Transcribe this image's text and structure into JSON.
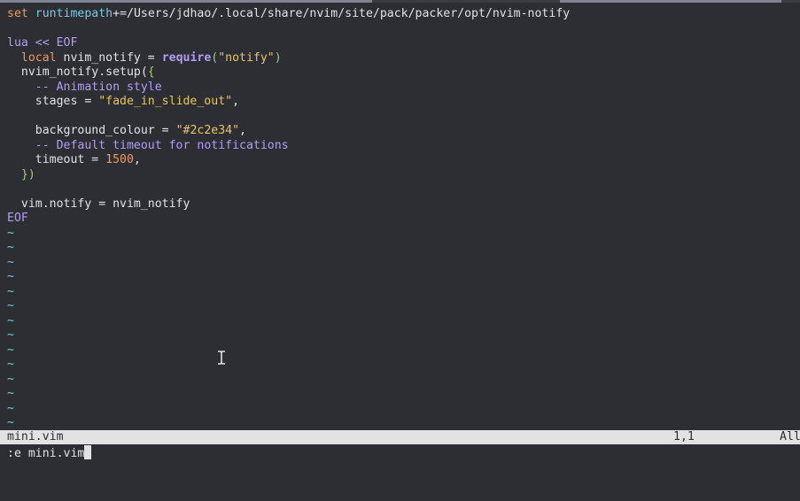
{
  "editor": {
    "lines": [
      [
        {
          "t": "set",
          "c": "kw"
        },
        {
          "t": " "
        },
        {
          "t": "runtimepath",
          "c": "hl"
        },
        {
          "t": "+=/Users/jdhao/.local/share/nvim/site/pack/packer/opt/nvim-notify"
        }
      ],
      [],
      [
        {
          "t": "lua << EOF",
          "c": "lua"
        }
      ],
      [
        {
          "t": "  "
        },
        {
          "t": "local",
          "c": "kw"
        },
        {
          "t": " nvim_notify = "
        },
        {
          "t": "require",
          "c": "bld"
        },
        {
          "t": "(",
          "c": "pnc"
        },
        {
          "t": "\"notify\"",
          "c": "str"
        },
        {
          "t": ")",
          "c": "pnc"
        }
      ],
      [
        {
          "t": "  nvim_notify.setup("
        },
        {
          "t": "{",
          "c": "pnc"
        }
      ],
      [
        {
          "t": "    "
        },
        {
          "t": "-- Animation style",
          "c": "com"
        }
      ],
      [
        {
          "t": "    stages = "
        },
        {
          "t": "\"fade_in_slide_out\"",
          "c": "str"
        },
        {
          "t": ","
        }
      ],
      [],
      [
        {
          "t": "    background_colour = "
        },
        {
          "t": "\"#2c2e34\"",
          "c": "str"
        },
        {
          "t": ","
        }
      ],
      [
        {
          "t": "    "
        },
        {
          "t": "-- Default timeout for notifications",
          "c": "com"
        }
      ],
      [
        {
          "t": "    timeout = "
        },
        {
          "t": "1500",
          "c": "num"
        },
        {
          "t": ","
        }
      ],
      [
        {
          "t": "  "
        },
        {
          "t": "}",
          "c": "pnc"
        },
        {
          "t": ")",
          "c": "pnc"
        }
      ],
      [],
      [
        {
          "t": "  vim.notify = nvim_notify"
        }
      ],
      [
        {
          "t": "EOF",
          "c": "lua"
        }
      ]
    ],
    "tilde_char": "~",
    "tilde_count": 14
  },
  "statusline": {
    "filename": "mini.vim",
    "position": "1,1",
    "percent": "All"
  },
  "cmdline": {
    "text": ":e mini.vim"
  },
  "colors": {
    "background": "#2c2e34",
    "foreground": "#e2e2e3",
    "keyword": "#f39660",
    "string": "#e7c664",
    "comment": "#b39df3",
    "highlight": "#76cce0",
    "paren": "#9ed072"
  },
  "icons": {
    "mouse_cursor": "i-beam-icon"
  }
}
